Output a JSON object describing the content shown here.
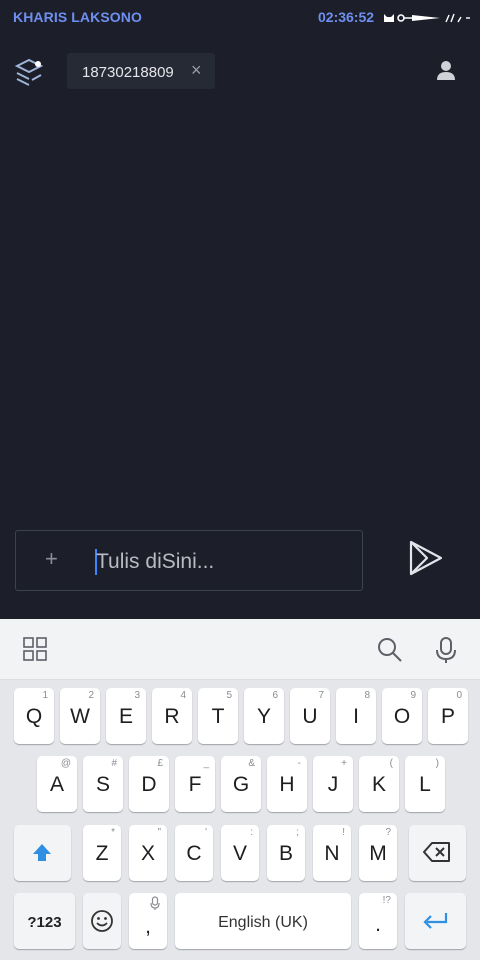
{
  "status_bar": {
    "carrier": "KHARIS LAKSONO",
    "time": "02:36:52"
  },
  "header": {
    "recipient_number": "18730218809",
    "chip_close": "×"
  },
  "compose": {
    "attach_symbol": "+",
    "placeholder": "Tulis diSini...",
    "value": ""
  },
  "keyboard": {
    "row1": [
      {
        "key": "Q",
        "hint": "1"
      },
      {
        "key": "W",
        "hint": "2"
      },
      {
        "key": "E",
        "hint": "3"
      },
      {
        "key": "R",
        "hint": "4"
      },
      {
        "key": "T",
        "hint": "5"
      },
      {
        "key": "Y",
        "hint": "6"
      },
      {
        "key": "U",
        "hint": "7"
      },
      {
        "key": "I",
        "hint": "8"
      },
      {
        "key": "O",
        "hint": "9"
      },
      {
        "key": "P",
        "hint": "0"
      }
    ],
    "row2": [
      {
        "key": "A",
        "hint": "@"
      },
      {
        "key": "S",
        "hint": "#"
      },
      {
        "key": "D",
        "hint": "£"
      },
      {
        "key": "F",
        "hint": "_"
      },
      {
        "key": "G",
        "hint": "&"
      },
      {
        "key": "H",
        "hint": "-"
      },
      {
        "key": "J",
        "hint": "+"
      },
      {
        "key": "K",
        "hint": "("
      },
      {
        "key": "L",
        "hint": ")"
      }
    ],
    "row3": [
      {
        "key": "Z",
        "hint": "*"
      },
      {
        "key": "X",
        "hint": "\""
      },
      {
        "key": "C",
        "hint": "'"
      },
      {
        "key": "V",
        "hint": ":"
      },
      {
        "key": "B",
        "hint": ";"
      },
      {
        "key": "N",
        "hint": "!"
      },
      {
        "key": "M",
        "hint": "?"
      }
    ],
    "symbols_label": "?123",
    "comma_label": ",",
    "space_label": "English (UK)",
    "period_label": ".",
    "period_hint": "!?"
  },
  "colors": {
    "background": "#1c1f2a",
    "status_text": "#6f8ff0",
    "accent_blue": "#2f8fe0"
  },
  "icons": {
    "menu": "layers-icon",
    "contact": "person-icon",
    "send": "send-arrow-icon",
    "apps": "grid-icon",
    "search": "search-icon",
    "mic": "microphone-icon",
    "shift": "shift-arrow-icon",
    "backspace": "backspace-icon",
    "emoji": "smiley-icon",
    "enter": "enter-arrow-icon"
  }
}
